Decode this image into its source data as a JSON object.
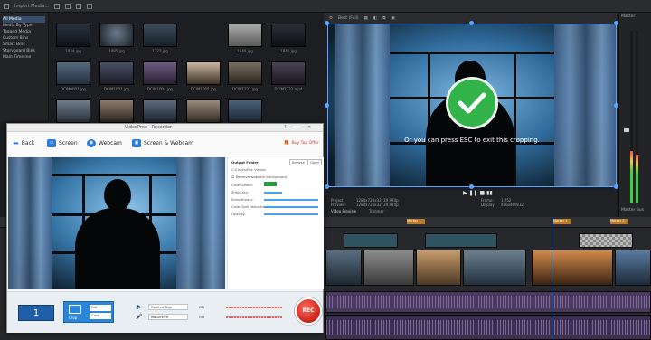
{
  "toolbar": {
    "import_media": "Import Media...",
    "best_full": "Best (Full)"
  },
  "tree": {
    "items": [
      "All Media",
      "Media By Type",
      "Tagged Media",
      "Custom Bins",
      "Smart Bins",
      "Storyboard Bins",
      "Main Timeline"
    ]
  },
  "media": {
    "labels": [
      "1034.jpg",
      "1085.jpg",
      "1722.jpg",
      "1840.jpg",
      "1841.jpg",
      "DCIM0001.jpg",
      "DCIM1001.jpg",
      "DCIM1004.jpg",
      "DCIM1005.jpg",
      "DCIM1221.jpg",
      "DCIM1222.mp4",
      "DCIM1224.jpg",
      "DCIM0001.jpg",
      "",
      "",
      "",
      "",
      ""
    ]
  },
  "preview": {
    "overlay_text": "Or you can press ESC to exit this cropping.",
    "project_label": "Project:",
    "project_value": "1280x720x32, 29.970p",
    "preview_label": "Preview:",
    "preview_value": "1280x720x32, 29.970p",
    "display_label": "Display:",
    "display_value": "416x469x32",
    "frame_label": "Frame:",
    "frame_value": "1,752",
    "tab_video_preview": "Video Preview",
    "tab_trimmer": "Trimmer"
  },
  "mixer": {
    "title": "Master",
    "bus": "Master Bus"
  },
  "timeline": {
    "markers": [
      "Marker 1",
      "Marker 2",
      "Marker 3"
    ]
  },
  "recorder": {
    "title": "VideoProc - Recorder",
    "back": "Back",
    "screen": "Screen",
    "webcam": "Webcam",
    "screen_webcam": "Screen & Webcam",
    "buy_offer": "Buy Top Offer",
    "output_folder": "Output Folder:",
    "output_path": "C:\\Users\\Rec Videos",
    "browse": "Browse",
    "open": "Open",
    "remove_bg": "Remove webcam background",
    "color_select": "Color Select:",
    "similarity": "Similarity:",
    "smoothness": "Smoothness:",
    "color_spill": "Color Spill Reduction:",
    "opacity": "Opacity:",
    "count": "1",
    "crop": "Crop",
    "full": "Full",
    "crop_small": "Crop",
    "audio_device": "Realtek Digi",
    "mic_device": "No Device",
    "on_label_1": "ON",
    "on_label_2": "ON",
    "rec": "REC"
  }
}
